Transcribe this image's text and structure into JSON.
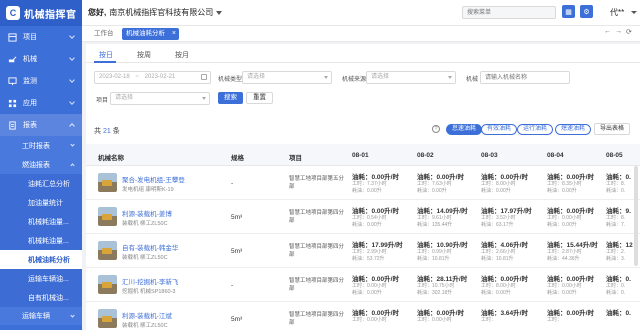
{
  "app": {
    "logo_text": "机械指挥官",
    "logo_mark": "C"
  },
  "sidebar": {
    "items": [
      {
        "label": "项目",
        "icon": "building-icon"
      },
      {
        "label": "机械",
        "icon": "excavator-icon"
      },
      {
        "label": "监测",
        "icon": "monitor-icon"
      },
      {
        "label": "应用",
        "icon": "apps-icon"
      },
      {
        "label": "报表",
        "icon": "report-icon"
      }
    ],
    "sub": [
      {
        "label": "工时报表"
      },
      {
        "label": "燃油报表"
      }
    ],
    "leaves": [
      {
        "label": "油耗汇总分析"
      },
      {
        "label": "加油量统计"
      },
      {
        "label": "机械耗油量..."
      },
      {
        "label": "机械耗油量..."
      },
      {
        "label": "机械油耗分析"
      },
      {
        "label": "运输车辆油..."
      },
      {
        "label": "自有机械油..."
      }
    ],
    "bottom": {
      "label": "运输车辆"
    }
  },
  "header": {
    "greeting": "您好,",
    "company": "南京机械指挥官科技有限公司",
    "search_placeholder": "搜索菜单",
    "user": "代**"
  },
  "tabs": {
    "home": "工作台",
    "active": "机械油耗分析",
    "close": "×",
    "ctrl": [
      "←",
      "→",
      "⟳"
    ]
  },
  "period_tabs": [
    "按日",
    "按周",
    "按月"
  ],
  "filters": {
    "date_start": "2023-02-18",
    "date_sep": "~",
    "date_end": "2023-02-21",
    "machine_type_label": "机械类型",
    "machine_source_label": "机械来源",
    "machine_label": "机械",
    "project_label": "项目",
    "select_placeholder": "请选择",
    "machine_name_placeholder": "请输入机械名称",
    "search_btn": "搜索",
    "reset_btn": "重置"
  },
  "summary": {
    "prefix": "共",
    "count": "21",
    "suffix": "条"
  },
  "toolbar": {
    "help": "?",
    "pills": [
      "怠速油耗",
      "有效油耗",
      "运行油耗",
      "熄速油耗"
    ],
    "export": "导出表格"
  },
  "table": {
    "headers": [
      "机械名称",
      "规格",
      "项目",
      "08-01",
      "08-02",
      "08-03",
      "08-04",
      "08-05"
    ],
    "rows": [
      {
        "name": "聚合-发电机组-王攀登",
        "sub": "发电机组 康明斯K-19",
        "spec": "-",
        "project": "智慧工地项目部第五分部",
        "cells": [
          {
            "main": "油耗：0.00升/时",
            "sub1": "工时：7.37小时",
            "sub2": "耗油：0.00升"
          },
          {
            "main": "油耗：0.00升/时",
            "sub1": "工时：7.63小时",
            "sub2": "耗油：0.00升"
          },
          {
            "main": "油耗：0.00升/时",
            "sub1": "工时：8.00小时",
            "sub2": "耗油：0.00升"
          },
          {
            "main": "油耗：0.00升/时",
            "sub1": "工时：8.35小时",
            "sub2": "耗油：0.00升"
          },
          {
            "main": "油耗：0.",
            "sub1": "工时：8.",
            "sub2": "耗油：0."
          }
        ]
      },
      {
        "name": "利源-装载机-姜博",
        "sub": "装载机 柳工ZL50C",
        "spec": "5m³",
        "project": "智慧工地项目部第四分部",
        "cells": [
          {
            "main": "油耗：0.00升/时",
            "sub1": "工时：0.54小时",
            "sub2": "耗油：0.00升"
          },
          {
            "main": "油耗：14.09升/时",
            "sub1": "工时：9.61小时",
            "sub2": "耗油：135.44升"
          },
          {
            "main": "油耗：17.97升/时",
            "sub1": "工时：3.52小时",
            "sub2": "耗油：63.17升"
          },
          {
            "main": "油耗：0.00升/时",
            "sub1": "工时：0.00小时",
            "sub2": "耗油：0.00升"
          },
          {
            "main": "油耗：9.",
            "sub1": "工时：8.",
            "sub2": "耗油：7."
          }
        ]
      },
      {
        "name": "自有-装载机-韩金华",
        "sub": "装载机 柳工ZL50C",
        "spec": "5m³",
        "project": "智慧工地项目部第四分部",
        "cells": [
          {
            "main": "油耗：17.99升/时",
            "sub1": "工时：2.99小时",
            "sub2": "耗油：53.72升"
          },
          {
            "main": "油耗：10.90升/时",
            "sub1": "工时：0.99小时",
            "sub2": "耗油：10.81升"
          },
          {
            "main": "油耗：4.06升/时",
            "sub1": "工时：2.66小时",
            "sub2": "耗油：10.81升"
          },
          {
            "main": "油耗：15.44升/时",
            "sub1": "工时：2.87小时",
            "sub2": "耗油：44.36升"
          },
          {
            "main": "油耗：12",
            "sub1": "工时：2.",
            "sub2": "耗油：3."
          }
        ]
      },
      {
        "name": "汇川-挖掘机-李新飞",
        "sub": "挖掘机 机械SP1860-3",
        "spec": "-",
        "project": "智慧工地项目部第四分部",
        "cells": [
          {
            "main": "油耗：0.00升/时",
            "sub1": "工时：0.00小时",
            "sub2": "耗油：0.00升"
          },
          {
            "main": "油耗：28.11升/时",
            "sub1": "工时：10.75小时",
            "sub2": "耗油：302.18升"
          },
          {
            "main": "油耗：0.00升/时",
            "sub1": "工时：8.00小时",
            "sub2": "耗油：0.00升"
          },
          {
            "main": "油耗：0.00升/时",
            "sub1": "工时：0.00小时",
            "sub2": "耗油：0.00升"
          },
          {
            "main": "油耗：0.",
            "sub1": "工时：0.",
            "sub2": "耗油：0."
          }
        ]
      },
      {
        "name": "利源-装载机-江斌",
        "sub": "装载机 柳工ZL50C",
        "spec": "5m³",
        "project": "智慧工地项目部第四分部",
        "cells": [
          {
            "main": "油耗：0.00升/时",
            "sub1": "工时：0.00小时",
            "sub2": ""
          },
          {
            "main": "油耗：0.00升/时",
            "sub1": "工时：0.00小时",
            "sub2": ""
          },
          {
            "main": "油耗：3.64升/时",
            "sub1": "工时：",
            "sub2": ""
          },
          {
            "main": "油耗：0.00升/时",
            "sub1": "工时：",
            "sub2": ""
          },
          {
            "main": "油耗：0.",
            "sub1": "",
            "sub2": ""
          }
        ]
      }
    ]
  },
  "colors": {
    "primary": "#3d6fd9",
    "sidebar": "#3d6fd9"
  }
}
